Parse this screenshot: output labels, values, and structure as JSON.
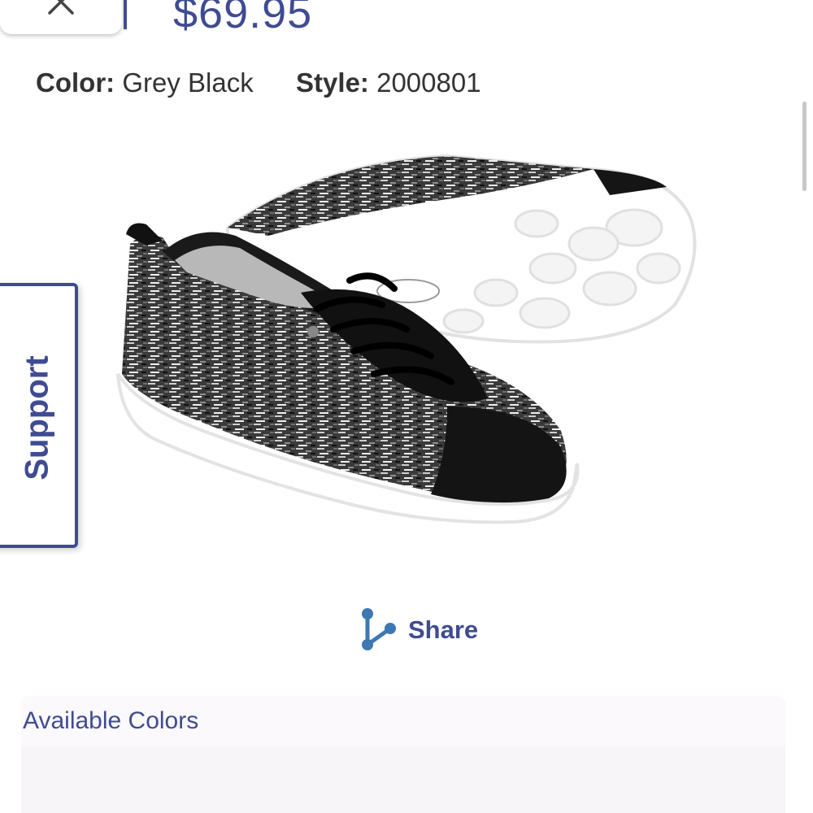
{
  "header": {
    "price": "$69.95"
  },
  "product": {
    "color_label": "Color:",
    "color_value": "Grey Black",
    "style_label": "Style:",
    "style_value": "2000801",
    "image_icon": "sneaker-image"
  },
  "support_tab": {
    "label": "Support"
  },
  "share": {
    "label": "Share",
    "icon": "share-icon"
  },
  "colors": {
    "title": "Available Colors"
  },
  "theme": {
    "accent": "#3f4b92",
    "text": "#333333",
    "share_icon_color": "#3d78b3"
  }
}
